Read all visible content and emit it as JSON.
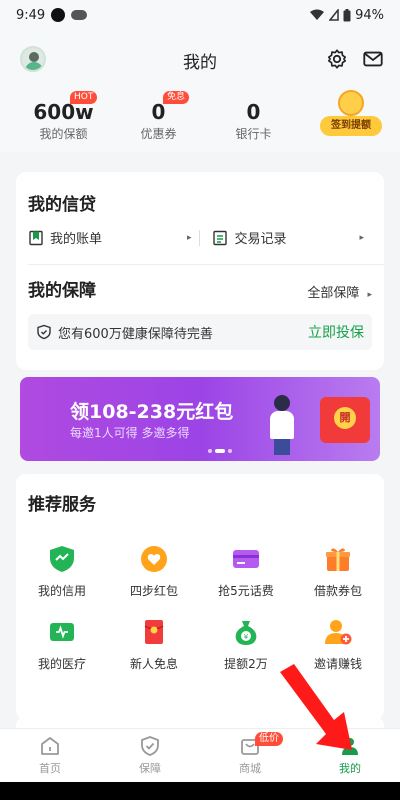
{
  "status": {
    "time": "9:49",
    "battery": "94%"
  },
  "header": {
    "title": "我的"
  },
  "stats": [
    {
      "value": "600w",
      "label": "我的保额",
      "tag": "HOT"
    },
    {
      "value": "0",
      "label": "优惠券",
      "tag": "免息"
    },
    {
      "value": "0",
      "label": "银行卡",
      "tag": ""
    }
  ],
  "checkin": {
    "label": "签到提额"
  },
  "credit": {
    "title": "我的信贷",
    "links": [
      {
        "label": "我的账单"
      },
      {
        "label": "交易记录"
      }
    ]
  },
  "protection": {
    "title": "我的保障",
    "all_label": "全部保障",
    "notice": "您有600万健康保障待完善",
    "action": "立即投保"
  },
  "banner": {
    "headline": "领108-238元红包",
    "sub": "每邀1人可得   多邀多得",
    "bag_label": "開"
  },
  "services": {
    "title": "推荐服务",
    "items": [
      {
        "label": "我的信用",
        "icon": "shield-icon"
      },
      {
        "label": "四步红包",
        "icon": "heart-coin-icon"
      },
      {
        "label": "抢5元话费",
        "icon": "card-icon"
      },
      {
        "label": "借款券包",
        "icon": "gift-icon"
      },
      {
        "label": "我的医疗",
        "icon": "medical-card-icon"
      },
      {
        "label": "新人免息",
        "icon": "red-envelope-icon"
      },
      {
        "label": "提额2万",
        "icon": "money-bag-icon"
      },
      {
        "label": "邀请赚钱",
        "icon": "invite-user-icon"
      }
    ]
  },
  "tabs": [
    {
      "label": "首页",
      "icon": "home-icon",
      "active": false,
      "badge": ""
    },
    {
      "label": "保障",
      "icon": "shield-check-icon",
      "active": false,
      "badge": ""
    },
    {
      "label": "商城",
      "icon": "mall-icon",
      "active": false,
      "badge": "低价"
    },
    {
      "label": "我的",
      "icon": "profile-icon",
      "active": true,
      "badge": ""
    }
  ],
  "colors": {
    "accent": "#1a9a4a",
    "hot": "#ff4d3a",
    "banner": "#9c44e6",
    "annotation_arrow": "#ff1a1a"
  }
}
